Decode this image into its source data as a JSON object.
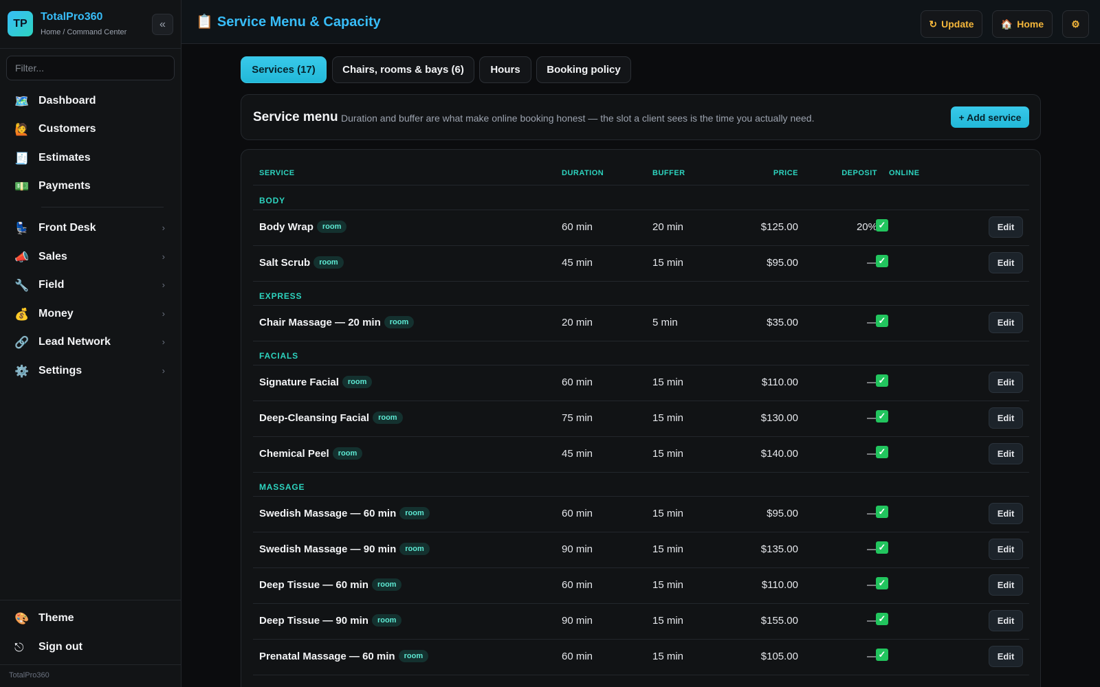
{
  "app": {
    "logo": "TP",
    "name": "TotalPro360",
    "breadcrumb": "Home / Command Center",
    "collapse_icon": "«",
    "footer": "TotalPro360"
  },
  "sidebar": {
    "filter_placeholder": "Filter...",
    "items": [
      {
        "icon": "🗺️",
        "label": "Dashboard"
      },
      {
        "icon": "🙋",
        "label": "Customers"
      },
      {
        "icon": "🧾",
        "label": "Estimates"
      },
      {
        "icon": "💵",
        "label": "Payments"
      },
      {
        "icon": "💺",
        "label": "Front Desk",
        "chevron": "›"
      },
      {
        "icon": "📣",
        "label": "Sales",
        "chevron": "›"
      },
      {
        "icon": "🔧",
        "label": "Field",
        "chevron": "›"
      },
      {
        "icon": "💰",
        "label": "Money",
        "chevron": "›"
      },
      {
        "icon": "🔗",
        "label": "Lead Network",
        "chevron": "›"
      },
      {
        "icon": "⚙️",
        "label": "Settings",
        "chevron": "›"
      }
    ],
    "bottom": [
      {
        "icon": "🎨",
        "label": "Theme"
      },
      {
        "icon": "⎋",
        "label": "Sign out"
      }
    ]
  },
  "header": {
    "icon": "📋",
    "title": "Service Menu & Capacity",
    "update_icon": "↻",
    "update_label": "Update",
    "home_icon": "🏠",
    "home_label": "Home",
    "settings_icon": "⚙"
  },
  "tabs": [
    {
      "label": "Services (17)",
      "active": true
    },
    {
      "label": "Chairs, rooms & bays (6)"
    },
    {
      "label": "Hours"
    },
    {
      "label": "Booking policy"
    }
  ],
  "service_menu": {
    "title": "Service menu",
    "description": "Duration and buffer are what make online booking honest — the slot a client sees is the time you actually need.",
    "add_label": "+ Add service"
  },
  "table": {
    "columns": [
      "SERVICE",
      "DURATION",
      "BUFFER",
      "PRICE",
      "DEPOSIT",
      "ONLINE"
    ],
    "edit_label": "Edit",
    "online_mark": "✓",
    "categories": [
      {
        "name": "BODY",
        "rows": [
          {
            "service": "Body Wrap",
            "tag": "room",
            "duration": "60 min",
            "buffer": "20 min",
            "price": "$125.00",
            "deposit": "20%"
          },
          {
            "service": "Salt Scrub",
            "tag": "room",
            "duration": "45 min",
            "buffer": "15 min",
            "price": "$95.00",
            "deposit": "—"
          }
        ]
      },
      {
        "name": "EXPRESS",
        "rows": [
          {
            "service": "Chair Massage — 20 min",
            "tag": "room",
            "duration": "20 min",
            "buffer": "5 min",
            "price": "$35.00",
            "deposit": "—"
          }
        ]
      },
      {
        "name": "FACIALS",
        "rows": [
          {
            "service": "Signature Facial",
            "tag": "room",
            "duration": "60 min",
            "buffer": "15 min",
            "price": "$110.00",
            "deposit": "—"
          },
          {
            "service": "Deep-Cleansing Facial",
            "tag": "room",
            "duration": "75 min",
            "buffer": "15 min",
            "price": "$130.00",
            "deposit": "—"
          },
          {
            "service": "Chemical Peel",
            "tag": "room",
            "duration": "45 min",
            "buffer": "15 min",
            "price": "$140.00",
            "deposit": "—"
          }
        ]
      },
      {
        "name": "MASSAGE",
        "rows": [
          {
            "service": "Swedish Massage — 60 min",
            "tag": "room",
            "duration": "60 min",
            "buffer": "15 min",
            "price": "$95.00",
            "deposit": "—"
          },
          {
            "service": "Swedish Massage — 90 min",
            "tag": "room",
            "duration": "90 min",
            "buffer": "15 min",
            "price": "$135.00",
            "deposit": "—"
          },
          {
            "service": "Deep Tissue — 60 min",
            "tag": "room",
            "duration": "60 min",
            "buffer": "15 min",
            "price": "$110.00",
            "deposit": "—"
          },
          {
            "service": "Deep Tissue — 90 min",
            "tag": "room",
            "duration": "90 min",
            "buffer": "15 min",
            "price": "$155.00",
            "deposit": "—"
          },
          {
            "service": "Prenatal Massage — 60 min",
            "tag": "room",
            "duration": "60 min",
            "buffer": "15 min",
            "price": "$105.00",
            "deposit": "—"
          }
        ]
      }
    ]
  }
}
